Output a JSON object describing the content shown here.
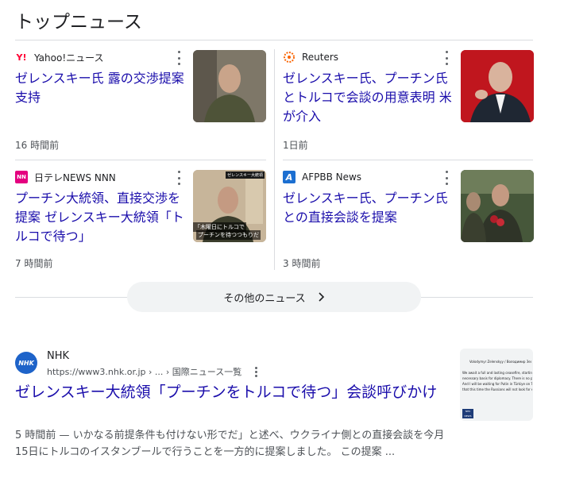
{
  "section_title": "トップニュース",
  "cards": [
    {
      "source": "Yahoo!ニュース",
      "headline": "ゼレンスキー氏 露の交渉提案支持",
      "time": "16 時間前"
    },
    {
      "source": "Reuters",
      "headline": "ゼレンスキー氏、プーチン氏とトルコで会談の用意表明 米が介入",
      "time": "1日前"
    },
    {
      "source": "日テレNEWS NNN",
      "headline": "プーチン大統領、直接交渉を提案 ゼレンスキー大統領「トルコで待つ」",
      "time": "7 時間前",
      "thumb_caption_top": "ゼレンスキー大統領",
      "thumb_caption_1": "「木曜日にトルコで",
      "thumb_caption_2": "プーチンを待つつもりだ"
    },
    {
      "source": "AFPBB News",
      "headline": "ゼレンスキー氏、プーチン氏との直接会談を提案",
      "time": "3 時間前"
    }
  ],
  "more_news_label": "その他のニュース",
  "result": {
    "site_name": "NHK",
    "logo_text": "NHK",
    "url": "https://www3.nhk.or.jp › ... › 国際ニュース一覧",
    "title": "ゼレンスキー大統領「プーチンをトルコで待つ」会談呼びかけ",
    "snippet": "5 時間前 — いかなる前提条件も付けない形でだ」と述べ、ウクライナ側との直接会談を今月15日にトルコのイスタンブールで行うことを一方的に提案しました。 この提案 ...",
    "thumb_author": "Volodymyr Zelenskyy / Володимир Зеленський",
    "thumb_lines": [
      "We await a full and lasting ceasefire, starting from",
      "necessary basis for diplomacy. There is no point",
      "And I will be waiting for Putin in Türkiye on Th",
      "that this time the Russians will not look for exc"
    ],
    "thumb_badge": "NHK NEWS"
  },
  "colors": {
    "link": "#1a0dab",
    "meta": "#4d5156",
    "divider": "#dadce0",
    "button_bg": "#f1f3f4"
  }
}
